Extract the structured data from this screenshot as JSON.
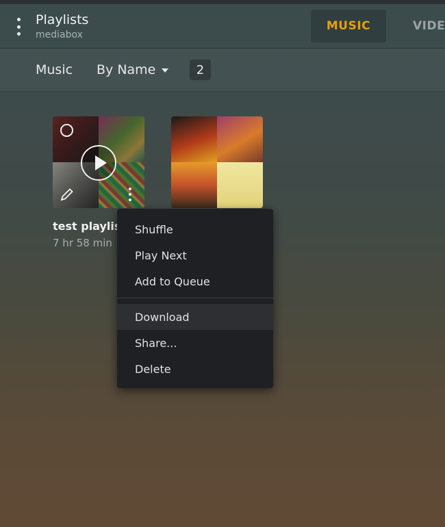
{
  "header": {
    "title": "Playlists",
    "subtitle": "mediabox",
    "tabs": [
      {
        "label": "MUSIC",
        "active": true
      },
      {
        "label": "VIDEO",
        "active": false
      }
    ],
    "accent_color": "#e5a00d"
  },
  "filter_bar": {
    "library_label": "Music",
    "sort_label": "By Name",
    "item_count": "2"
  },
  "playlists": [
    {
      "title": "test playlist",
      "duration": "7 hr 58 min"
    },
    {
      "title": "",
      "duration": ""
    }
  ],
  "context_menu": {
    "items": [
      {
        "label": "Shuffle"
      },
      {
        "label": "Play Next"
      },
      {
        "label": "Add to Queue"
      },
      {
        "label": "Download",
        "highlighted": true
      },
      {
        "label": "Share..."
      },
      {
        "label": "Delete"
      }
    ]
  }
}
